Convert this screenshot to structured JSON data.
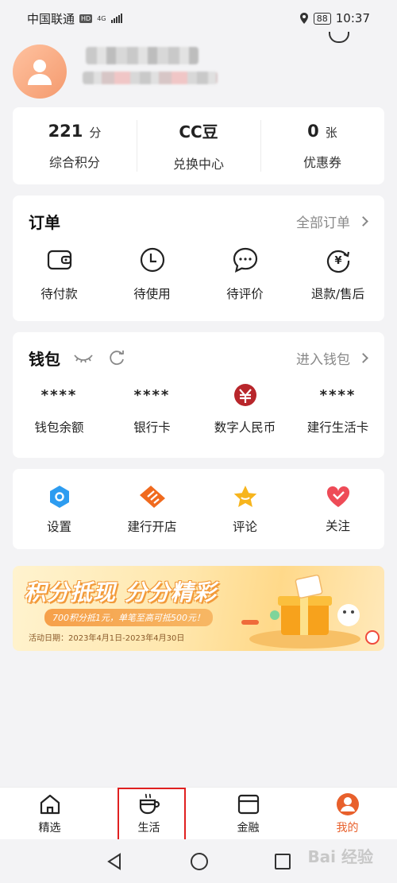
{
  "status_bar": {
    "carrier": "中国联通",
    "hd": "HD",
    "network": "4G",
    "battery": "88",
    "time": "10:37"
  },
  "stats": [
    {
      "value": "221",
      "unit": "分",
      "label": "综合积分"
    },
    {
      "value": "CC豆",
      "unit": "",
      "label": "兑换中心"
    },
    {
      "value": "0",
      "unit": "张",
      "label": "优惠券"
    }
  ],
  "orders": {
    "title": "订单",
    "link": "全部订单",
    "items": [
      "待付款",
      "待使用",
      "待评价",
      "退款/售后"
    ]
  },
  "wallet": {
    "title": "钱包",
    "link": "进入钱包",
    "items": [
      {
        "value": "****",
        "label": "钱包余额"
      },
      {
        "value": "****",
        "label": "银行卡"
      },
      {
        "value": "",
        "label": "数字人民币"
      },
      {
        "value": "****",
        "label": "建行生活卡"
      }
    ]
  },
  "tools": [
    "设置",
    "建行开店",
    "评论",
    "关注"
  ],
  "banner": {
    "title": "积分抵现 分分精彩",
    "subtitle": "700积分抵1元，单笔至高可抵500元！",
    "date": "活动日期：2023年4月1日-2023年4月30日"
  },
  "bottom_nav": [
    "精选",
    "生活",
    "金融",
    "我的"
  ],
  "watermark": "Bai 经验",
  "colors": {
    "accent": "#e8602c",
    "highlight": "#e02020",
    "background": "#f3f3f5"
  }
}
